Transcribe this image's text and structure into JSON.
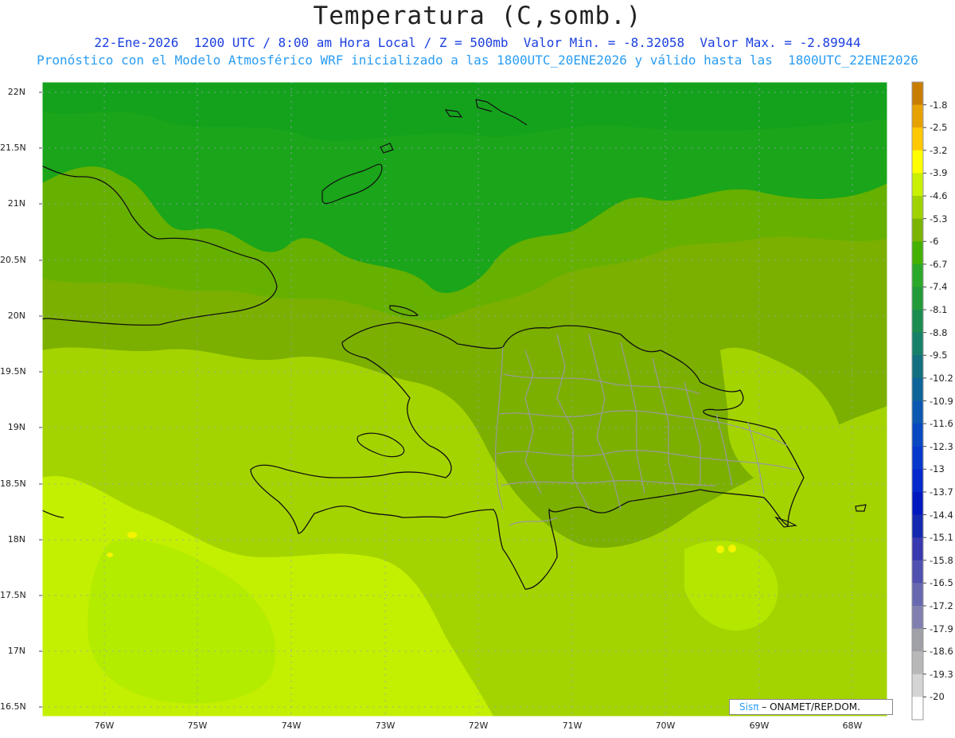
{
  "title": "Temperatura (C,somb.)",
  "subtitle_line1": "22-Ene-2026  1200 UTC / 8:00 am Hora Local / Z = 500mb  Valor Min. = -8.32058  Valor Max. = -2.89944",
  "subtitle_line2": "Pronóstico con el Modelo Atmosférico WRF inicializado a las 1800UTC_20ENE2026 y válido hasta las  1800UTC_22ENE2026",
  "lat_labels": [
    "22N",
    "21.5N",
    "21N",
    "20.5N",
    "20N",
    "19.5N",
    "19N",
    "18.5N",
    "18N",
    "17.5N",
    "17N",
    "16.5N"
  ],
  "lon_labels": [
    "76W",
    "75W",
    "74W",
    "73W",
    "72W",
    "71W",
    "70W",
    "69W",
    "68W"
  ],
  "colorbar": {
    "labels": [
      "-1.8",
      "-2.5",
      "-3.2",
      "-3.9",
      "-4.6",
      "-5.3",
      "-6",
      "-6.7",
      "-7.4",
      "-8.1",
      "-8.8",
      "-9.5",
      "-10.2",
      "-10.9",
      "-11.6",
      "-12.3",
      "-13",
      "-13.7",
      "-14.4",
      "-15.1",
      "-15.8",
      "-16.5",
      "-17.2",
      "-17.9",
      "-18.6",
      "-19.3",
      "-20"
    ],
    "colors": [
      "#c87c00",
      "#e6a200",
      "#ffc800",
      "#ffff00",
      "#c8f000",
      "#a0d200",
      "#7ab400",
      "#44b000",
      "#2aa82a",
      "#229a3a",
      "#1a8c50",
      "#168068",
      "#127080",
      "#0e6498",
      "#0a58b0",
      "#0848c0",
      "#0638cc",
      "#0428cc",
      "#0018c0",
      "#1428b0",
      "#3838b0",
      "#5050b0",
      "#6868b0",
      "#8080b0",
      "#a0a0a8",
      "#b8b8b8",
      "#d4d4d4",
      "#ffffff"
    ]
  },
  "map_colors": {
    "dark_green": "#1aa51a",
    "green": "#5ab000",
    "olive_green": "#7bb000",
    "yellow_green": "#a4d400",
    "lime": "#c3f000",
    "yellow": "#f4f400",
    "border": "#9a9a9a",
    "coast": "#111111"
  },
  "credit": {
    "brand": "Sisπ",
    "text": " – ONAMET/REP.DOM."
  }
}
